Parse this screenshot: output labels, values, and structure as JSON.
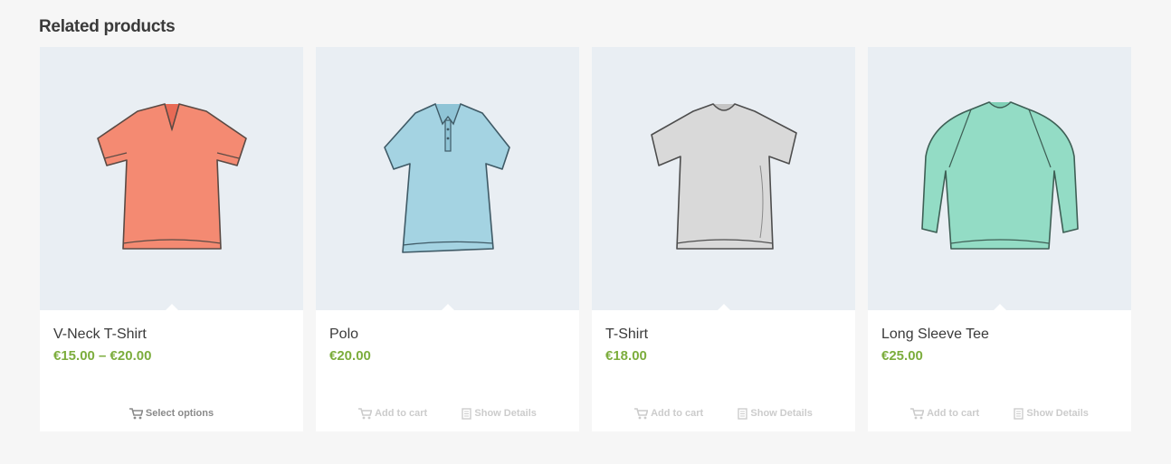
{
  "section": {
    "title": "Related products"
  },
  "colors": {
    "price": "#7cad3d",
    "image_bg": "#e9eef3",
    "page_bg": "#f6f6f6"
  },
  "products": [
    {
      "title": "V-Neck T-Shirt",
      "price": "€15.00 – €20.00",
      "image": {
        "kind": "vneck-tshirt-icon",
        "color": "#f48a72"
      },
      "actions": [
        {
          "label": "Select options",
          "icon": "cart-icon"
        }
      ]
    },
    {
      "title": "Polo",
      "price": "€20.00",
      "image": {
        "kind": "polo-shirt-icon",
        "color": "#a4d3e2"
      },
      "actions": [
        {
          "label": "Add to cart",
          "icon": "cart-icon"
        },
        {
          "label": "Show Details",
          "icon": "document-icon"
        }
      ]
    },
    {
      "title": "T-Shirt",
      "price": "€18.00",
      "image": {
        "kind": "tshirt-icon",
        "color": "#d9d9d9"
      },
      "actions": [
        {
          "label": "Add to cart",
          "icon": "cart-icon"
        },
        {
          "label": "Show Details",
          "icon": "document-icon"
        }
      ]
    },
    {
      "title": "Long Sleeve Tee",
      "price": "€25.00",
      "image": {
        "kind": "long-sleeve-tee-icon",
        "color": "#93dcc5"
      },
      "actions": [
        {
          "label": "Add to cart",
          "icon": "cart-icon"
        },
        {
          "label": "Show Details",
          "icon": "document-icon"
        }
      ]
    }
  ]
}
